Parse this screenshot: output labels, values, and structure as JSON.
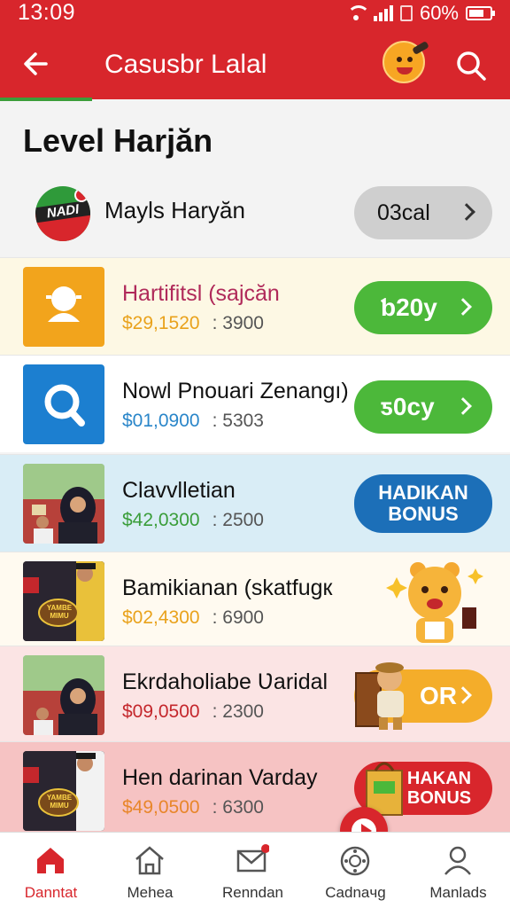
{
  "status": {
    "time": "13:09",
    "battery": "60%"
  },
  "header": {
    "title": "Casusbr Lalal"
  },
  "level": {
    "title": "Level Harjăn",
    "user_logo_text": "NADI",
    "user_name": "Mayls Haryăn",
    "button_label": "03cal"
  },
  "rows": [
    {
      "title": "Hartifitsl (sajcăn",
      "amount": "$29,1520",
      "count": ": 3900",
      "action": "ƅ20y",
      "title_color": "#b02a5a",
      "amount_color": "#e9a21c"
    },
    {
      "title": "Nowl Pnouari Zenangı)",
      "amount": "$01,0900",
      "count": ": 5303",
      "action": "ƽ0cy",
      "title_color": "#111111",
      "amount_color": "#2a86c9"
    },
    {
      "title": "Clavvlletian",
      "amount": "$42,0300",
      "count": ": 2500",
      "action_line1": "HADIKAN",
      "action_line2": "BONUS",
      "title_color": "#111111",
      "amount_color": "#3a9d3a"
    },
    {
      "title": "Bamikianan (skatfugк",
      "amount": "$02,4300",
      "count": ": 6900",
      "title_color": "#111111",
      "amount_color": "#e9a21c",
      "thumb_text": "YAMBE MIMU"
    },
    {
      "title": "Ekrdaholiabe Ʋaridal",
      "amount": "$09,0500",
      "count": ": 2300",
      "action": "OR",
      "title_color": "#111111",
      "amount_color": "#c4272c"
    },
    {
      "title": "Hen darinan Varday",
      "amount": "$49,0500",
      "count": ": 6300",
      "action_line1": "HAKAN",
      "action_line2": "BONUS",
      "title_color": "#111111",
      "amount_color": "#e8862a",
      "thumb_text": "YAMBE MIMU"
    }
  ],
  "nav": [
    {
      "label": "Danntat",
      "active": true
    },
    {
      "label": "Mehea"
    },
    {
      "label": "Renndan"
    },
    {
      "label": "Cadnaчg"
    },
    {
      "label": "Manlads"
    }
  ],
  "colors": {
    "brand_red": "#d8262c",
    "green": "#4cb83a",
    "blue": "#1c6fb8"
  },
  "icons": [
    "back-arrow-icon",
    "mascot-icon",
    "search-icon",
    "trophy-icon",
    "magnifier-icon",
    "home-icon",
    "house-icon",
    "mail-icon",
    "dial-icon",
    "user-icon",
    "play-icon"
  ]
}
